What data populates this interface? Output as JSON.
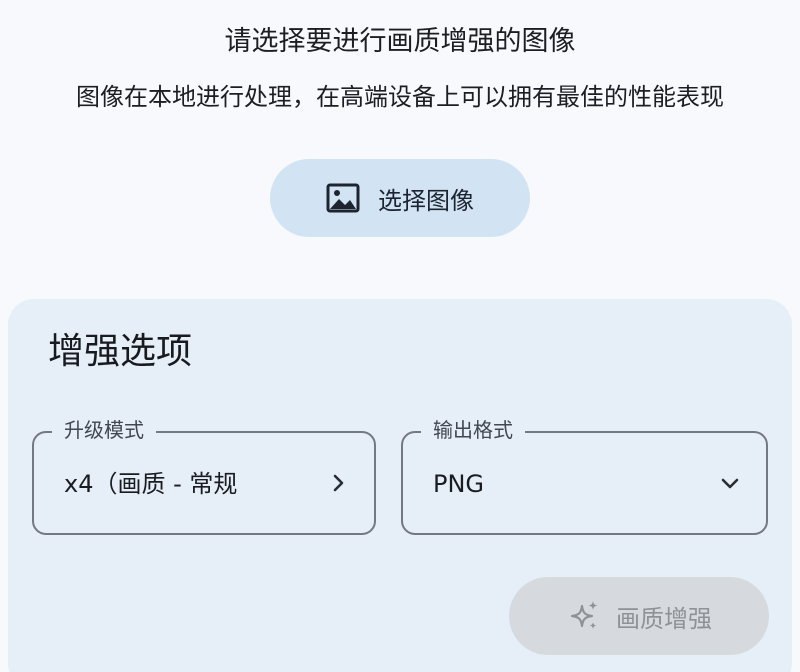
{
  "header": {
    "title": "请选择要进行画质增强的图像",
    "subtitle": "图像在本地进行处理，在高端设备上可以拥有最佳的性能表现"
  },
  "select_image_button": {
    "label": "选择图像",
    "icon": "image-icon"
  },
  "options_card": {
    "title": "增强选项",
    "upscale_mode": {
      "label": "升级模式",
      "value": "x4（画质 - 常规",
      "trailing_icon": "chevron-right-icon"
    },
    "output_format": {
      "label": "输出格式",
      "value": "PNG",
      "trailing_icon": "chevron-down-icon"
    },
    "enhance_button": {
      "label": "画质增强",
      "icon": "sparkle-icon",
      "enabled": false
    }
  },
  "colors": {
    "background": "#f8f9fd",
    "select_button_bg": "#d2e4f3",
    "card_bg": "#e6eef7",
    "field_border": "#747880",
    "disabled_button_bg": "#d6dade",
    "disabled_text": "#8e9297"
  }
}
